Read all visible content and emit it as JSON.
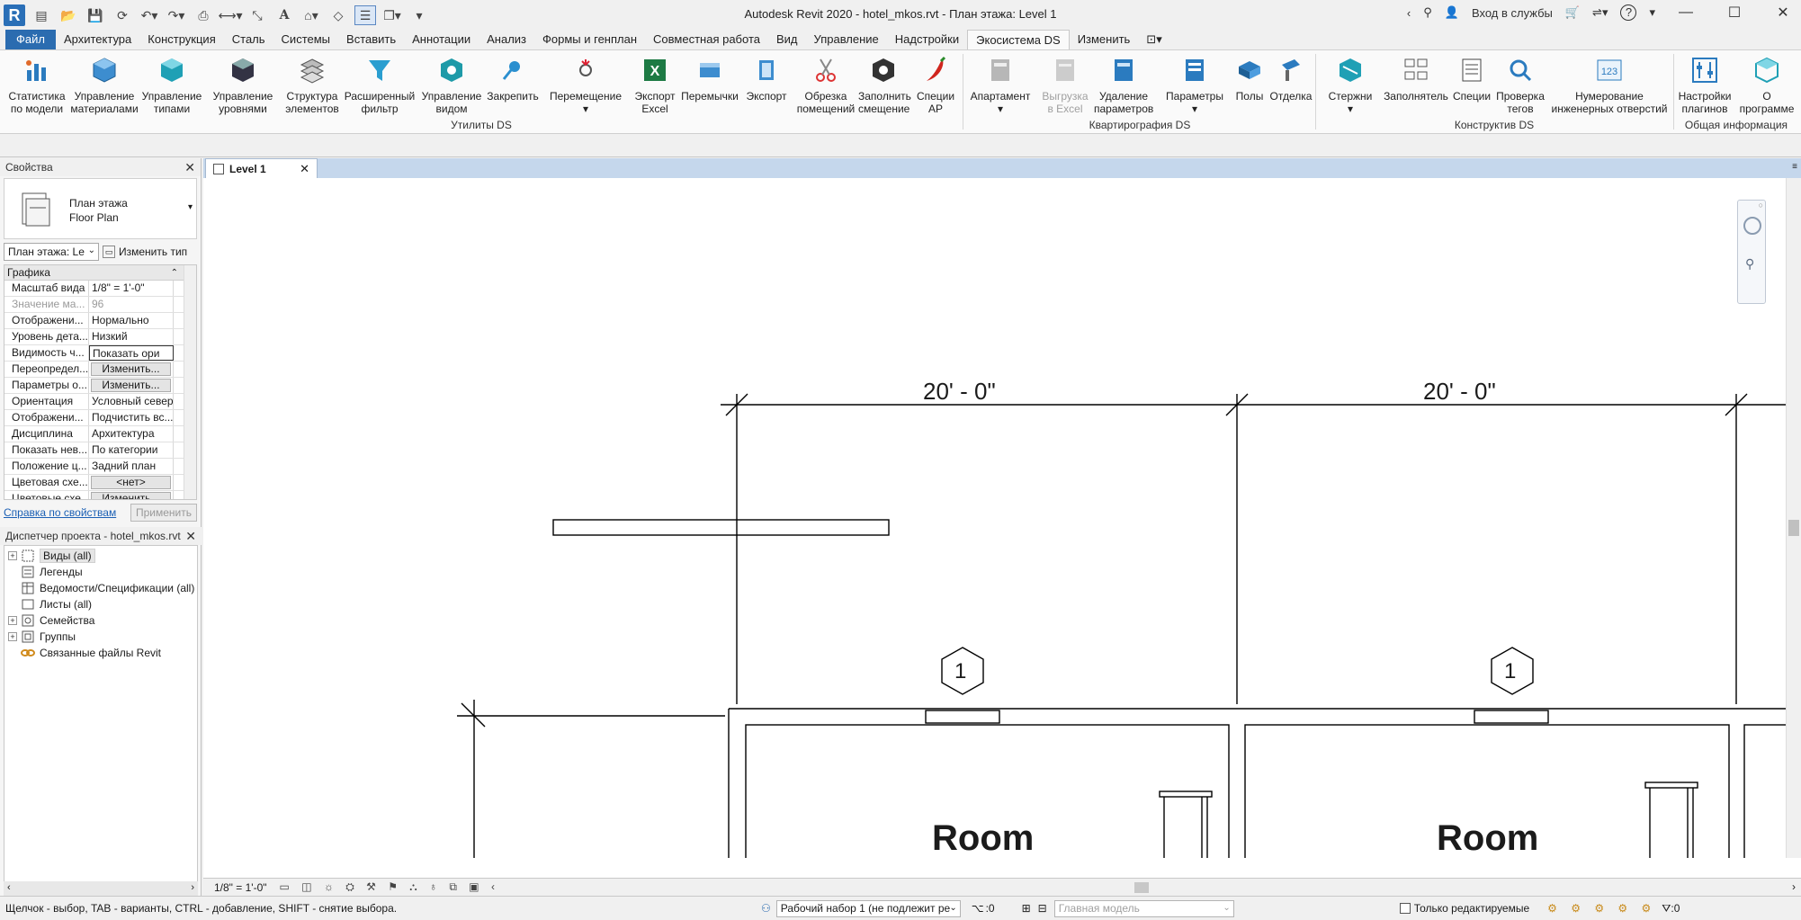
{
  "app": {
    "title": "Autodesk Revit 2020 - hotel_mkos.rvt - План этажа: Level 1",
    "signin": "Вход в службы",
    "help": "?"
  },
  "tabs": [
    "Файл",
    "Архитектура",
    "Конструкция",
    "Сталь",
    "Системы",
    "Вставить",
    "Аннотации",
    "Анализ",
    "Формы и генплан",
    "Совместная работа",
    "Вид",
    "Управление",
    "Надстройки",
    "Экосистема DS",
    "Изменить"
  ],
  "ribbon": {
    "panels": [
      {
        "label": "Утилиты DS"
      },
      {
        "label": "Квартирография DS"
      },
      {
        "label": "Конструктив DS"
      },
      {
        "label": "Общая информация"
      }
    ],
    "buttons": [
      {
        "l1": "Статистика",
        "l2": "по модели"
      },
      {
        "l1": "Управление",
        "l2": "материалами"
      },
      {
        "l1": "Управление",
        "l2": "типами"
      },
      {
        "l1": "Управление",
        "l2": "уровнями"
      },
      {
        "l1": "Структура",
        "l2": "элементов"
      },
      {
        "l1": "Расширенный",
        "l2": "фильтр"
      },
      {
        "l1": "Управление",
        "l2": "видом"
      },
      {
        "l1": "Закрепить",
        "l2": ""
      },
      {
        "l1": "Перемещение",
        "l2": ""
      },
      {
        "l1": "Экспорт",
        "l2": "Excel"
      },
      {
        "l1": "Перемычки",
        "l2": ""
      },
      {
        "l1": "Экспорт",
        "l2": ""
      },
      {
        "l1": "Обрезка",
        "l2": "помещений"
      },
      {
        "l1": "Заполнить",
        "l2": "смещение"
      },
      {
        "l1": "Специи",
        "l2": "АР"
      },
      {
        "l1": "Апартамент",
        "l2": ""
      },
      {
        "l1": "Выгрузка",
        "l2": "в Excel"
      },
      {
        "l1": "Удаление",
        "l2": "параметров"
      },
      {
        "l1": "Параметры",
        "l2": ""
      },
      {
        "l1": "Полы",
        "l2": ""
      },
      {
        "l1": "Отделка",
        "l2": ""
      },
      {
        "l1": "Стержни",
        "l2": ""
      },
      {
        "l1": "Заполнятель",
        "l2": ""
      },
      {
        "l1": "Специи",
        "l2": ""
      },
      {
        "l1": "Проверка",
        "l2": "тегов"
      },
      {
        "l1": "Нумерование",
        "l2": "инженерных отверстий"
      },
      {
        "l1": "Настройки",
        "l2": "плагинов"
      },
      {
        "l1": "О",
        "l2": "программе"
      }
    ]
  },
  "properties": {
    "header": "Свойства",
    "type_l1": "План этажа",
    "type_l2": "Floor Plan",
    "view_select": "План этажа: Le",
    "edit_type": "Изменить тип",
    "category": "Графика",
    "rows": [
      {
        "k": "Масштаб вида",
        "v": "1/8\" = 1'-0\""
      },
      {
        "k": "Значение ма...",
        "v": "96"
      },
      {
        "k": "Отображени...",
        "v": "Нормально"
      },
      {
        "k": "Уровень дета...",
        "v": "Низкий"
      },
      {
        "k": "Видимость ч...",
        "v": "Показать ори"
      },
      {
        "k": "Переопредел...",
        "v": "Изменить..."
      },
      {
        "k": "Параметры о...",
        "v": "Изменить..."
      },
      {
        "k": "Ориентация",
        "v": "Условный север"
      },
      {
        "k": "Отображени...",
        "v": "Подчистить вс..."
      },
      {
        "k": "Дисциплина",
        "v": "Архитектура"
      },
      {
        "k": "Показать нев...",
        "v": "По категории"
      },
      {
        "k": "Положение ц...",
        "v": "Задний план"
      },
      {
        "k": "Цветовая схе...",
        "v": "<нет>"
      },
      {
        "k": "Цветовые схе...",
        "v": "Изменить..."
      }
    ],
    "help_link": "Справка по свойствам",
    "apply": "Применить"
  },
  "browser": {
    "header": "Диспетчер проекта - hotel_mkos.rvt",
    "items": [
      "Виды (all)",
      "Легенды",
      "Ведомости/Спецификации (all)",
      "Листы (all)",
      "Семейства",
      "Группы",
      "Связанные файлы Revit"
    ]
  },
  "view": {
    "tab": "Level 1",
    "dim1": "20' - 0\"",
    "dim2": "20' - 0\"",
    "tag1": "1",
    "tag2": "1",
    "room1": "Room",
    "room2": "Room",
    "scale": "1/8\" = 1'-0\""
  },
  "status": {
    "hint": "Щелчок - выбор, TAB - варианты, CTRL - добавление, SHIFT - снятие выбора.",
    "workset": "Рабочий набор 1 (не подлежит ре",
    "count1": ":0",
    "model": "Главная модель",
    "editable": "Только редактируемые",
    "count2": ":0"
  }
}
